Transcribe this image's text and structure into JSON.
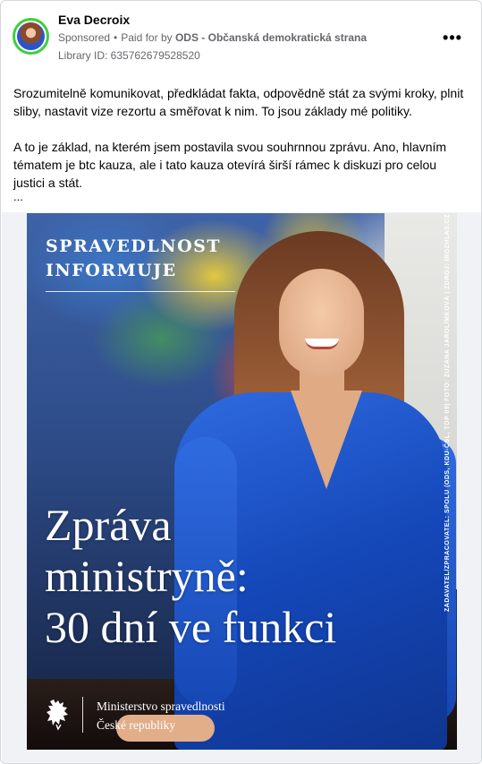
{
  "post": {
    "author_name": "Eva Decroix",
    "sponsored_label": "Sponsored",
    "separator": "•",
    "paid_for_prefix": "Paid for by",
    "payer": "ODS - Občanská demokratická strana",
    "library_id": "Library ID: 635762679528520",
    "more_icon": "more-options-icon",
    "more_glyph": "•••",
    "text_paragraph_1": "Srozumitelně komunikovat, předkládat fakta, odpovědně stát za svými kroky, plnit sliby, nastavit vize rezortu a směřovat k nim. To jsou základy mé politiky.",
    "text_paragraph_2": "A to je základ, na kterém jsem postavila svou souhrnnou zprávu. Ano, hlavním tématem je btc kauza, ale i tato kauza otevírá širší rámec k diskuzi pro celou justici a stát.",
    "see_more": "..."
  },
  "creative": {
    "top_line_1": "SPRAVEDLNOST",
    "top_line_2": "INFORMUJE",
    "photo_credit": "FOTO: ZUZANA JAROLÍMKOVÁ | ZDROJ: IROZHLAS.CZ",
    "sponsor_credit": "ZADAVATEL/ZPRACOVATEL: SPOLU (ODS, KDU-ČSL, TOP 09)",
    "headline_line_1": "Zpráva",
    "headline_line_2": "ministryně:",
    "headline_line_3": "30 dní ve funkci",
    "ministry_line_1": "Ministerstvo spravedlnosti",
    "ministry_line_2": "České republiky",
    "emblem_icon": "lion-emblem-icon"
  },
  "colors": {
    "avatar_ring": "#3ecf3e",
    "meta_text": "#65676b",
    "dress_blue": "#1447b8"
  }
}
